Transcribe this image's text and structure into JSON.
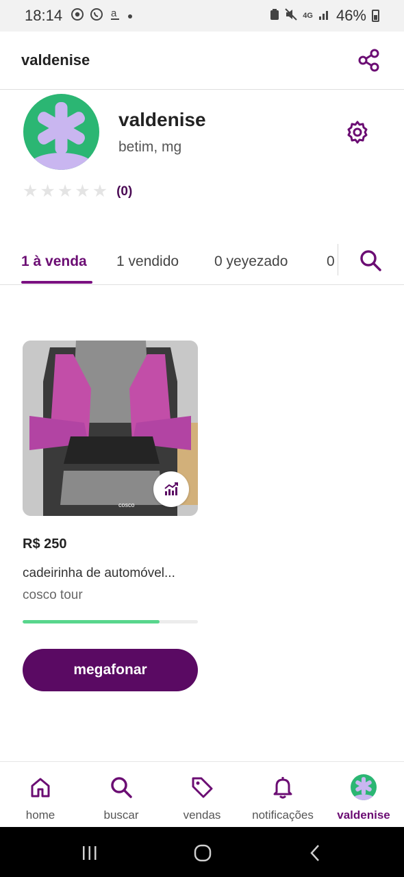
{
  "status_bar": {
    "time": "18:14",
    "battery": "46%",
    "network": "4G",
    "left_icons": [
      "chrome-icon",
      "whatsapp-icon",
      "amazon-icon",
      "dot-icon"
    ],
    "right_icons": [
      "battery-saver-icon",
      "mute-icon",
      "network-4g-icon",
      "signal-icon",
      "battery-icon"
    ]
  },
  "header": {
    "title": "valdenise",
    "share_icon": "share-icon"
  },
  "profile": {
    "name": "valdenise",
    "location": "betim, mg",
    "rating_stars": 5,
    "rating_value": 0,
    "rating_count": "(0)",
    "settings_icon": "gear-icon",
    "avatar_colors": {
      "background": "#2bb673",
      "flower": "#c9b6f0"
    }
  },
  "tabs": [
    {
      "label": "1 à venda",
      "active": true
    },
    {
      "label": "1 vendido",
      "active": false
    },
    {
      "label": "0 yeyezado",
      "active": false
    },
    {
      "label": "0",
      "active": false
    }
  ],
  "product": {
    "price": "R$ 250",
    "title": "cadeirinha de automóvel...",
    "brand": "cosco tour",
    "image_text": "cosco",
    "progress": 0.78,
    "boost_icon": "chart-up-icon"
  },
  "megafonar_button": {
    "label": "megafonar"
  },
  "bottom_nav": [
    {
      "label": "home",
      "icon": "home-icon",
      "active": false
    },
    {
      "label": "buscar",
      "icon": "search-icon",
      "active": false
    },
    {
      "label": "vendas",
      "icon": "tag-icon",
      "active": false
    },
    {
      "label": "notificações",
      "icon": "bell-icon",
      "active": false
    },
    {
      "label": "valdenise",
      "icon": "avatar",
      "active": true
    }
  ],
  "colors": {
    "primary": "#6b0d73",
    "button": "#5a0a63",
    "progress": "#58d68d",
    "star_empty": "#e4e4e4"
  }
}
